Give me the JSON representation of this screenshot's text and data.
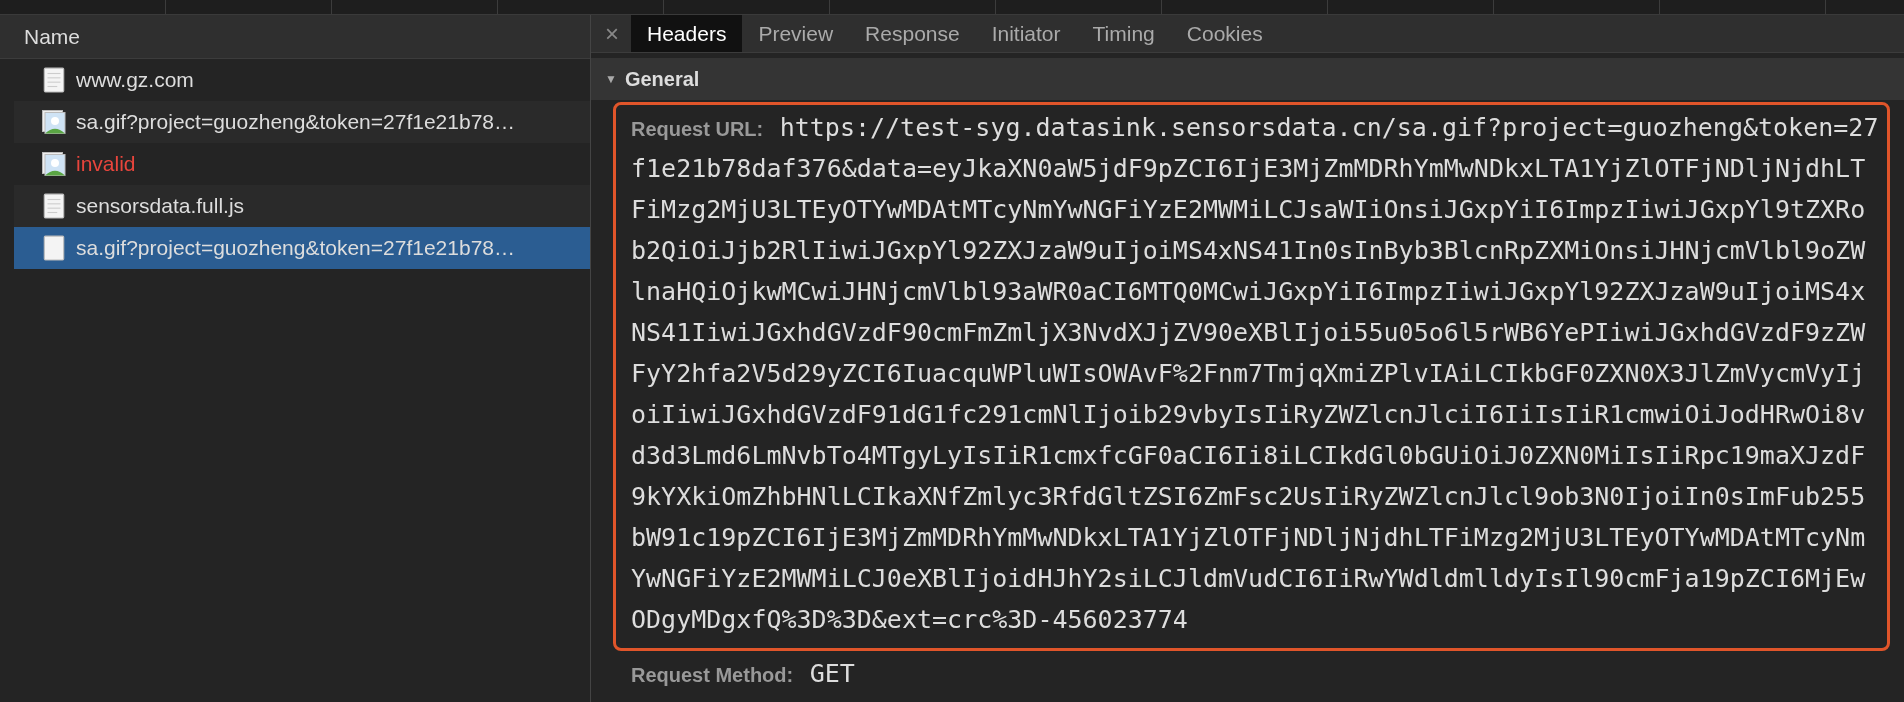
{
  "requests": {
    "column": "Name",
    "rows": [
      {
        "kind": "document",
        "name": "www.gz.com",
        "error": false,
        "selected": false
      },
      {
        "kind": "image",
        "name": "sa.gif?project=guozheng&token=27f1e21b78…",
        "error": false,
        "selected": false
      },
      {
        "kind": "image",
        "name": "invalid",
        "error": true,
        "selected": false
      },
      {
        "kind": "document",
        "name": "sensorsdata.full.js",
        "error": false,
        "selected": false
      },
      {
        "kind": "document",
        "name": "sa.gif?project=guozheng&token=27f1e21b78…",
        "error": false,
        "selected": true
      }
    ]
  },
  "detail": {
    "close": "×",
    "tabs": [
      {
        "label": "Headers",
        "selected": true
      },
      {
        "label": "Preview",
        "selected": false
      },
      {
        "label": "Response",
        "selected": false
      },
      {
        "label": "Initiator",
        "selected": false
      },
      {
        "label": "Timing",
        "selected": false
      },
      {
        "label": "Cookies",
        "selected": false
      }
    ],
    "section": {
      "title": "General",
      "expanded": true,
      "caret": "▼",
      "fields": [
        {
          "label": "Request URL:",
          "value": "https://test-syg.datasink.sensorsdata.cn/sa.gif?project=guozheng&token=27f1e21b78daf376&data=eyJkaXN0aW5jdF9pZCI6IjE3MjZmMDRhYmMwNDkxLTA1YjZlOTFjNDljNjdhLTFiMzg2MjU3LTEyOTYwMDAtMTcyNmYwNGFiYzE2MWMiLCJsaWIiOnsiJGxpYiI6ImpzIiwiJGxpYl9tZXRob2QiOiJjb2RlIiwiJGxpYl92ZXJzaW9uIjoiMS4xNS41In0sInByb3BlcnRpZXMiOnsiJHNjcmVlbl9oZWlnaHQiOjkwMCwiJHNjcmVlbl93aWR0aCI6MTQ0MCwiJGxpYiI6ImpzIiwiJGxpYl92ZXJzaW9uIjoiMS4xNS41IiwiJGxhdGVzdF90cmFmZmljX3NvdXJjZV90eXBlIjoi55u05o6l5rWB6YePIiwiJGxhdGVzdF9zZWFyY2hfa2V5d29yZCI6IuacquWPluWIsOWAvF%2Fnm7TmjqXmiZPlvIAiLCIkbGF0ZXN0X3JlZmVycmVyIjoiIiwiJGxhdGVzdF91dG1fc291cmNlIjoib29vbyIsIiRyZWZlcnJlciI6IiIsIiR1cmwiOiJodHRwOi8vd3d3Lmd6LmNvbTo4MTgyLyIsIiR1cmxfcGF0aCI6Ii8iLCIkdGl0bGUiOiJ0ZXN0MiIsIiRpc19maXJzdF9kYXkiOmZhbHNlLCIkaXNfZmlyc3RfdGltZSI6ZmFsc2UsIiRyZWZlcnJlcl9ob3N0IjoiIn0sImFub255bW91c19pZCI6IjE3MjZmMDRhYmMwNDkxLTA1YjZlOTFjNDljNjdhLTFiMzg2MjU3LTEyOTYwMDAtMTcyNmYwNGFiYzE2MWMiLCJ0eXBlIjoidHJhY2siLCJldmVudCI6IiRwYWdldmlldyIsIl90cmFja19pZCI6MjEwODgyMDgxfQ%3D%3D&ext=crc%3D-456023774",
          "highlighted": true
        },
        {
          "label": "Request Method:",
          "value": "GET",
          "highlighted": false
        }
      ]
    }
  }
}
